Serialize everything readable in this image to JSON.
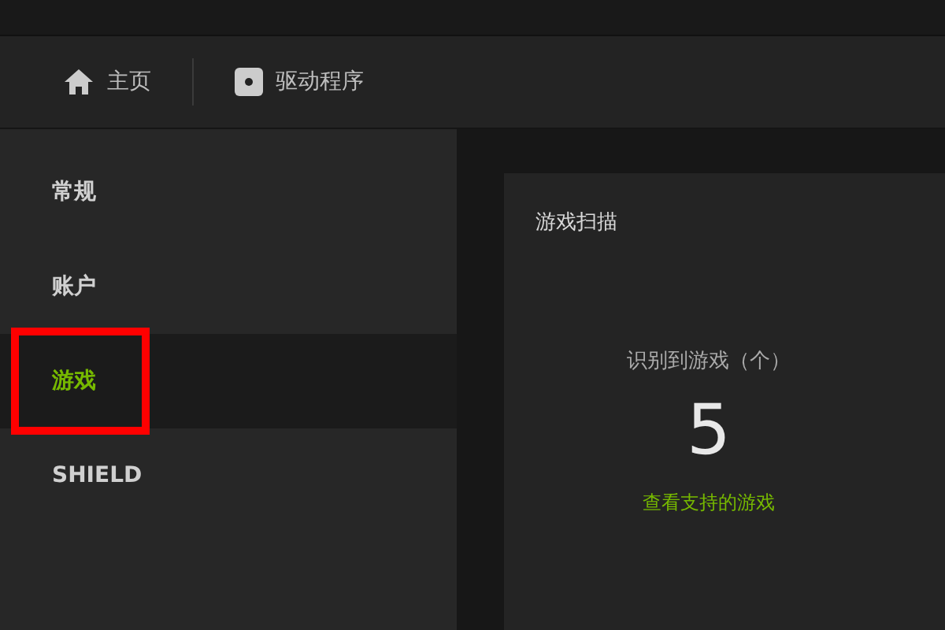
{
  "nav": [
    {
      "kind": "home",
      "label": "主页"
    },
    {
      "kind": "driver",
      "label": "驱动程序"
    }
  ],
  "sidebar": {
    "items": [
      {
        "label": "常规",
        "selected": false,
        "highlighted": false
      },
      {
        "label": "账户",
        "selected": false,
        "highlighted": false
      },
      {
        "label": "游戏",
        "selected": true,
        "highlighted": true
      },
      {
        "label": "SHIELD",
        "selected": false,
        "highlighted": false
      }
    ]
  },
  "card": {
    "title": "游戏扫描",
    "label": "识别到游戏（个）",
    "count": "5",
    "link": "查看支持的游戏"
  }
}
